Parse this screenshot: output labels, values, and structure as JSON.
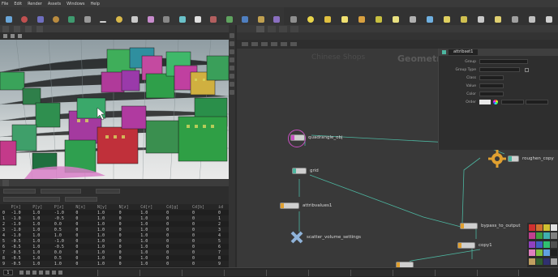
{
  "colors": {
    "accent": "#3f8f7a",
    "wire": "#4db6a0",
    "selected": "#c94fc2",
    "gear": "#e0a030",
    "path_text": "#d7b14a"
  },
  "network": {
    "title_watermark": "Chinese Shops",
    "context": "Geometry",
    "nodes": [
      {
        "label": "quadrangle_obj",
        "icon": "quad-icon"
      },
      {
        "label": "grid"
      },
      {
        "label": "attribvalues1"
      },
      {
        "label": "scatter_volume_settings",
        "icon": "x-icon"
      },
      {
        "label": "roughen_copy",
        "icon": "gear-icon"
      },
      {
        "label": "bypass_to_output"
      },
      {
        "label": "copy1"
      }
    ]
  },
  "params": {
    "node_name": "attribset1",
    "rows": [
      "Group",
      "Group Type",
      "Class",
      "Value",
      "Color",
      "Order"
    ]
  },
  "spreadsheet": {
    "columns": [
      "",
      "P[x]",
      "P[y]",
      "P[z]",
      "N[x]",
      "N[y]",
      "N[z]",
      "Cd[r]",
      "Cd[g]",
      "Cd[b]",
      "id"
    ],
    "rows": [
      [
        "0",
        "-1.0",
        "1.0",
        "-1.0",
        "0",
        "1.0",
        "0",
        "1.0",
        "0",
        "0",
        "0"
      ],
      [
        "1",
        "-1.0",
        "1.0",
        "-0.5",
        "0",
        "1.0",
        "0",
        "1.0",
        "0",
        "0",
        "1"
      ],
      [
        "2",
        "-1.0",
        "1.0",
        "0.0",
        "0",
        "1.0",
        "0",
        "1.0",
        "0",
        "0",
        "2"
      ],
      [
        "3",
        "-1.0",
        "1.0",
        "0.5",
        "0",
        "1.0",
        "0",
        "1.0",
        "0",
        "0",
        "3"
      ],
      [
        "4",
        "-1.0",
        "1.0",
        "1.0",
        "0",
        "1.0",
        "0",
        "1.0",
        "0",
        "0",
        "4"
      ],
      [
        "5",
        "-0.5",
        "1.0",
        "-1.0",
        "0",
        "1.0",
        "0",
        "1.0",
        "0",
        "0",
        "5"
      ],
      [
        "6",
        "-0.5",
        "1.0",
        "-0.5",
        "0",
        "1.0",
        "0",
        "1.0",
        "0",
        "0",
        "6"
      ],
      [
        "7",
        "-0.5",
        "1.0",
        "0.0",
        "0",
        "1.0",
        "0",
        "1.0",
        "0",
        "0",
        "7"
      ],
      [
        "8",
        "-0.5",
        "1.0",
        "0.5",
        "0",
        "1.0",
        "0",
        "1.0",
        "0",
        "0",
        "8"
      ],
      [
        "9",
        "-0.5",
        "1.0",
        "1.0",
        "0",
        "1.0",
        "0",
        "1.0",
        "0",
        "0",
        "9"
      ]
    ]
  },
  "timeline": {
    "frame": "1"
  }
}
